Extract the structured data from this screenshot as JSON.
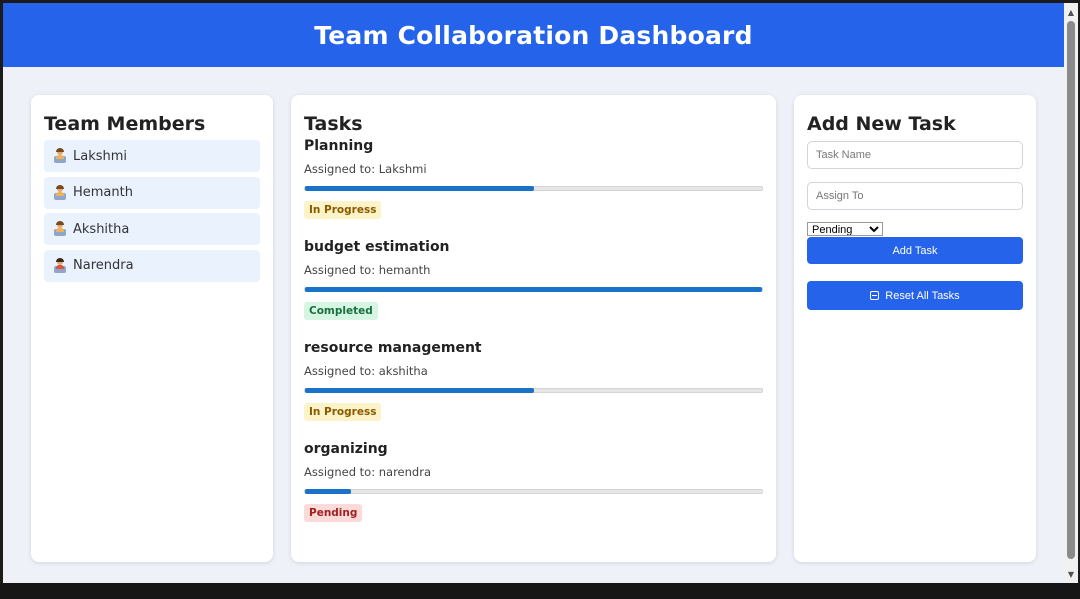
{
  "header": {
    "title": "Team Collaboration Dashboard"
  },
  "colors": {
    "header_bg": "#2563eb",
    "button_bg": "#2563eb",
    "progress_fill": "#1a73c8",
    "member_bg": "#eaf2fe"
  },
  "members": {
    "title": "Team Members",
    "items": [
      {
        "name": "Lakshmi",
        "icon": "technologist-icon"
      },
      {
        "name": "Hemanth",
        "icon": "technologist-icon"
      },
      {
        "name": "Akshitha",
        "icon": "technologist-icon"
      },
      {
        "name": "Narendra",
        "icon": "technologist-icon"
      }
    ]
  },
  "tasks": {
    "title": "Tasks",
    "items": [
      {
        "name": "Planning",
        "assigned": "Assigned to: Lakshmi",
        "progress": 0.5,
        "status": "In Progress"
      },
      {
        "name": "budget estimation",
        "assigned": "Assigned to: hemanth",
        "progress": 1.0,
        "status": "Completed"
      },
      {
        "name": "resource management",
        "assigned": "Assigned to: akshitha",
        "progress": 0.5,
        "status": "In Progress"
      },
      {
        "name": "organizing",
        "assigned": "Assigned to: narendra",
        "progress": 0.1,
        "status": "Pending"
      }
    ]
  },
  "add_task": {
    "title": "Add New Task",
    "task_name_placeholder": "Task Name",
    "assign_to_placeholder": "Assign To",
    "status_selected": "Pending",
    "add_button": "Add Task",
    "reset_button": "Reset All Tasks"
  }
}
